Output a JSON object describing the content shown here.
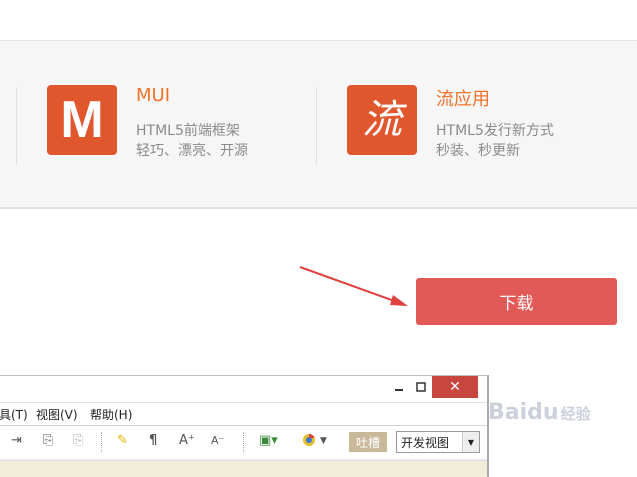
{
  "features": [
    {
      "title": "MUI",
      "logo_glyph": "M",
      "lines": [
        "HTML5前端框架",
        "轻巧、漂亮、开源"
      ]
    },
    {
      "title": "流应用",
      "logo_glyph": "流",
      "lines": [
        "HTML5发行新方式",
        "秒装、秒更新"
      ]
    }
  ],
  "download_button": {
    "label": "下载"
  },
  "app_window": {
    "menu": [
      "具(T)",
      "视图(V)",
      "帮助(H)"
    ],
    "tucao_label": "吐槽",
    "view_select": {
      "value": "开发视图"
    },
    "close_glyph": "✕"
  },
  "watermark": {
    "text": "Baidu",
    "suffix": "经验"
  },
  "colors": {
    "accent": "#f07229",
    "logo_bg": "#e0572e",
    "download_bg": "#e15a58",
    "close_bg": "#c7463d"
  },
  "icons": [
    "m-logo-icon",
    "liu-logo-icon",
    "red-arrow-icon",
    "minimize-icon",
    "maximize-icon",
    "close-icon"
  ]
}
